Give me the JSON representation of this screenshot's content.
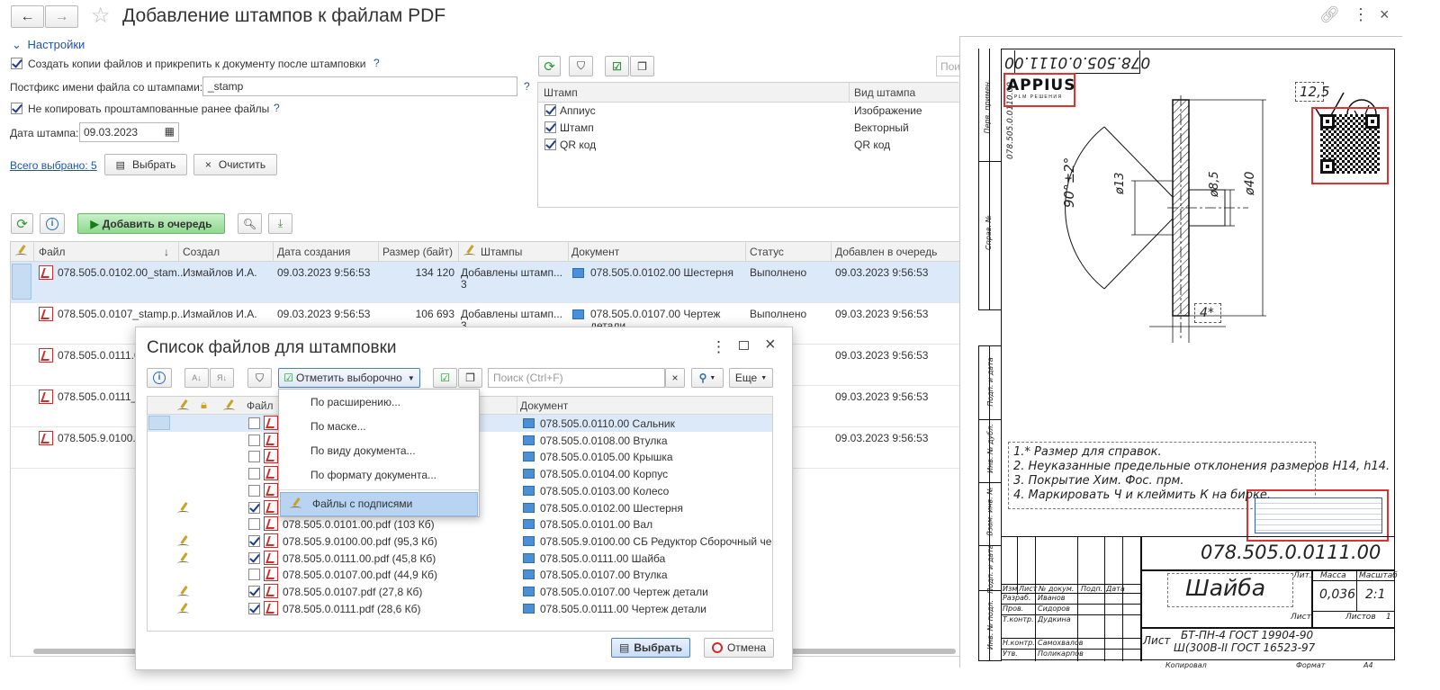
{
  "window": {
    "title": "Добавление штампов к файлам PDF"
  },
  "settings": {
    "section_label": "Настройки",
    "create_copies": {
      "label": "Создать копии файлов и прикрепить к документу после штамповки",
      "checked": true,
      "help": "?"
    },
    "postfix": {
      "label": "Постфикс имени файла со штампами:",
      "value": "_stamp",
      "help": "?"
    },
    "no_copy": {
      "label": "Не копировать проштампованные ранее файлы",
      "checked": true,
      "help": "?"
    },
    "stamp_date": {
      "label": "Дата штампа:",
      "value": "09.03.2023"
    },
    "total_selected": "Всего выбрано: 5",
    "select_btn": "Выбрать",
    "clear_btn": "Очистить"
  },
  "stamps": {
    "search_placeholder": "Пои",
    "columns": [
      "Штамп",
      "Вид штампа"
    ],
    "rows": [
      {
        "name": "Аппиус",
        "kind": "Изображение",
        "checked": true
      },
      {
        "name": "Штамп",
        "kind": "Векторный",
        "checked": true
      },
      {
        "name": "QR код",
        "kind": "QR код",
        "checked": true
      }
    ]
  },
  "queue": {
    "add_btn": "Добавить в очередь",
    "columns": [
      "Файл",
      "Создал",
      "Дата создания",
      "Размер (байт)",
      "Штампы",
      "Документ",
      "Статус",
      "Добавлен в очередь"
    ],
    "sort_indicator": "↓",
    "rows": [
      {
        "file": "078.505.0.0102.00_stam...",
        "author": "Измайлов И.А.",
        "created": "09.03.2023 9:56:53",
        "size": "134 120",
        "stamps": "Добавлены штамп...",
        "stamps2": "3",
        "doc": "078.505.0.0102.00 Шестерня",
        "doc2": "",
        "status": "Выполнено",
        "queued": "09.03.2023 9:56:53"
      },
      {
        "file": "078.505.0.0107_stamp.p...",
        "author": "Измайлов И.А.",
        "created": "09.03.2023 9:56:53",
        "size": "106 693",
        "stamps": "Добавлены штамп...",
        "stamps2": "3",
        "doc": "078.505.0.0107.00 Чертеж",
        "doc2": "детали",
        "status": "Выполнено",
        "queued": "09.03.2023 9:56:53"
      },
      {
        "file": "078.505.0.0111.00",
        "queued": "09.03.2023 9:56:53"
      },
      {
        "file": "078.505.0.0111_s",
        "queued": "09.03.2023 9:56:53"
      },
      {
        "file": "078.505.9.0100.00",
        "queued": "09.03.2023 9:56:53"
      }
    ]
  },
  "dialog": {
    "title": "Список файлов для штамповки",
    "mark_btn": "Отметить выборочно",
    "search_placeholder": "Поиск (Ctrl+F)",
    "more_btn": "Еще",
    "col_file": "Файл",
    "col_doc": "Документ",
    "menu": [
      "По расширению...",
      "По маске...",
      "По виду документа...",
      "По формату документа...",
      "Файлы с подписями"
    ],
    "rows": [
      {
        "file": "",
        "doc": "078.505.0.0110.00 Сальник",
        "checked": false,
        "signed": false
      },
      {
        "file": "",
        "doc": "078.505.0.0108.00 Втулка",
        "checked": false,
        "signed": false
      },
      {
        "file": "",
        "doc": "078.505.0.0105.00 Крышка",
        "checked": false,
        "signed": false
      },
      {
        "file": "",
        "doc": "078.505.0.0104.00 Корпус",
        "checked": false,
        "signed": false
      },
      {
        "file": "",
        "doc": "078.505.0.0103.00 Колесо",
        "checked": false,
        "signed": false
      },
      {
        "file": "",
        "doc": "078.505.0.0102.00 Шестерня",
        "checked": true,
        "signed": true
      },
      {
        "file": "078.505.0.0101.00.pdf (103 Кб)",
        "doc": "078.505.0.0101.00 Вал",
        "checked": false,
        "signed": false
      },
      {
        "file": "078.505.9.0100.00.pdf (95,3 Кб)",
        "doc": "078.505.9.0100.00 СБ Редуктор Сборочный че...",
        "checked": true,
        "signed": true
      },
      {
        "file": "078.505.0.0111.00.pdf (45,8 Кб)",
        "doc": "078.505.0.0111.00 Шайба",
        "checked": true,
        "signed": true
      },
      {
        "file": "078.505.0.0107.00.pdf (44,9 Кб)",
        "doc": "078.505.0.0107.00 Втулка",
        "checked": false,
        "signed": false
      },
      {
        "file": "078.505.0.0107.pdf (27,8 Кб)",
        "doc": "078.505.0.0107.00 Чертеж детали",
        "checked": true,
        "signed": true
      },
      {
        "file": "078.505.0.0111.pdf (28,6 Кб)",
        "doc": "078.505.0.0111.00 Чертеж детали",
        "checked": true,
        "signed": true
      }
    ],
    "ok_btn": "Выбрать",
    "cancel_btn": "Отмена"
  },
  "drawing": {
    "top_number": "078.505.0.0111.00",
    "logo": "APPIUS",
    "logo_sub": "PLM РЕШЕНИЯ",
    "roughness": "12,5",
    "angle": "90°±2°",
    "dim1": "ø13",
    "dim2": "ø8,5",
    "dim3": "ø40",
    "dim4": "4*",
    "notes": [
      "1.* Размер для справок.",
      "2. Неуказанные предельные отклонения размеров H14, h14.",
      "3. Покрытие  Хим. Фос. прм.",
      "4. Маркировать Ч и клеймить К на бирке."
    ],
    "title_number": "078.505.0.0111.00",
    "part_name": "Шайба",
    "material1": "БТ-ПН-4 ГОСТ 19904-90",
    "material2": "Ш(300В-II ГОСТ 16523-97",
    "mass": "0,036",
    "scale": "2:1",
    "tb_labels": [
      "Изм",
      "Лист",
      "№ докум.",
      "Подп.",
      "Дата",
      "Разраб.",
      "Пров.",
      "Т.контр.",
      "Н.контр.",
      "Утв.",
      "Лит.",
      "Масса",
      "Масштаб",
      "Лист",
      "Листов",
      "Копировал",
      "Формат",
      "А4"
    ],
    "tb_names": [
      "Иванов",
      "Сидоров",
      "Дудкина",
      "Самохвалов",
      "Поликарпов"
    ],
    "sheets": "1",
    "lim_text": "Лист",
    "side_labels": [
      "Перв. примен.",
      "Справ. №",
      "Подп. и дата",
      "Инв. № дубл.",
      "Взам. инв. №",
      "Подп. и дата",
      "Инв. № подл."
    ],
    "side_number": "078.505.0.0110.00"
  },
  "colors": {
    "accent": "#1f55a7",
    "selection": "#dbe9f8",
    "green": "#2c9a35",
    "red_box": "#e03030"
  }
}
